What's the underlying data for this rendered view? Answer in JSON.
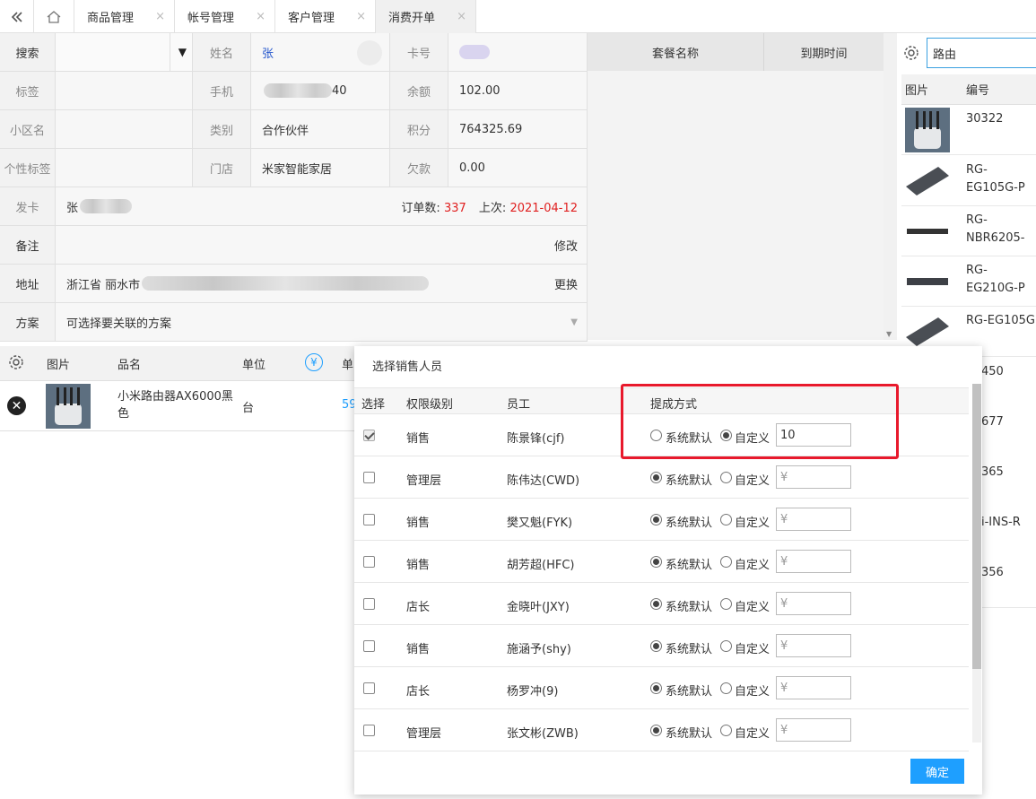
{
  "tabs": [
    {
      "label": "商品管理"
    },
    {
      "label": "帐号管理"
    },
    {
      "label": "客户管理"
    },
    {
      "label": "消费开单"
    }
  ],
  "form": {
    "search_label": "搜索",
    "name_label": "姓名",
    "name_value": "张",
    "card_label": "卡号",
    "tag_label": "标签",
    "phone_label": "手机",
    "phone_suffix": "40",
    "balance_label": "余额",
    "balance_value": "102.00",
    "district_label": "小区名",
    "category_label": "类别",
    "category_value": "合作伙伴",
    "points_label": "积分",
    "points_value": "764325.69",
    "ptag_label": "个性标签",
    "store_label": "门店",
    "store_value": "米家智能家居",
    "debt_label": "欠款",
    "debt_value": "0.00",
    "issue_label": "发卡",
    "issue_value": "张",
    "orders_label": "订单数:",
    "orders_value": "337",
    "last_label": "上次:",
    "last_value": "2021-04-12",
    "note_label": "备注",
    "note_action": "修改",
    "address_label": "地址",
    "address_value": "浙江省 丽水市",
    "address_action": "更换",
    "plan_label": "方案",
    "plan_placeholder": "可选择要关联的方案"
  },
  "package": {
    "col1": "套餐名称",
    "col2": "到期时间"
  },
  "right_panel": {
    "search_value": "路由",
    "col_image": "图片",
    "col_code": "编号",
    "items": [
      {
        "code": "30322"
      },
      {
        "code": "RG-EG105G-P"
      },
      {
        "code": "RG-NBR6205-"
      },
      {
        "code": "RG-EG210G-P"
      },
      {
        "code": "RG-EG105G"
      }
    ],
    "partial": [
      "450",
      "677",
      "365",
      "i-INS-R",
      "356"
    ]
  },
  "products": {
    "col_image": "图片",
    "col_name": "品名",
    "col_unit": "单位",
    "col_price_symbol": "¥",
    "col_price": "单",
    "row": {
      "name": "小米路由器AX6000黑色",
      "unit": "台",
      "price": "59"
    }
  },
  "modal": {
    "title": "选择销售人员",
    "col_select": "选择",
    "col_level": "权限级别",
    "col_staff": "员工",
    "col_commission": "提成方式",
    "opt_default": "系统默认",
    "opt_custom": "自定义",
    "confirm": "确定",
    "rows": [
      {
        "level": "销售",
        "staff": "陈景锋(cjf)",
        "checked": true,
        "mode": "custom",
        "input": "10"
      },
      {
        "level": "管理层",
        "staff": "陈伟达(CWD)",
        "checked": false,
        "mode": "default",
        "input": "¥"
      },
      {
        "level": "销售",
        "staff": "樊又魁(FYK)",
        "checked": false,
        "mode": "default",
        "input": "¥"
      },
      {
        "level": "销售",
        "staff": "胡芳超(HFC)",
        "checked": false,
        "mode": "default",
        "input": "¥"
      },
      {
        "level": "店长",
        "staff": "金晓叶(JXY)",
        "checked": false,
        "mode": "default",
        "input": "¥"
      },
      {
        "level": "销售",
        "staff": "施涵予(shy)",
        "checked": false,
        "mode": "default",
        "input": "¥"
      },
      {
        "level": "店长",
        "staff": "杨罗冲(9)",
        "checked": false,
        "mode": "default",
        "input": "¥"
      },
      {
        "level": "管理层",
        "staff": "张文彬(ZWB)",
        "checked": false,
        "mode": "default",
        "input": "¥"
      }
    ]
  },
  "colors": {
    "accent": "#1e9fff",
    "highlight": "#e8192c",
    "red_text": "#e02020"
  }
}
